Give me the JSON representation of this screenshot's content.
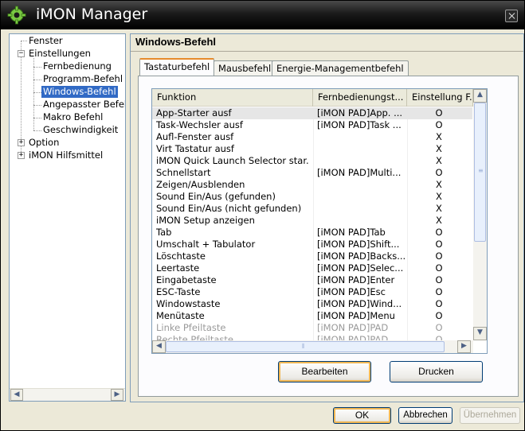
{
  "window": {
    "title": "iMON Manager"
  },
  "tree": {
    "items": [
      {
        "label": "Fenster"
      },
      {
        "label": "Einstellungen"
      },
      {
        "label": "Fernbedienung"
      },
      {
        "label": "Programm-Befehl"
      },
      {
        "label": "Windows-Befehl"
      },
      {
        "label": "Angepasster Befeh"
      },
      {
        "label": "Makro  Befehl"
      },
      {
        "label": "Geschwindigkeit"
      },
      {
        "label": "Option"
      },
      {
        "label": "iMON Hilfsmittel"
      }
    ]
  },
  "panel": {
    "title": "Windows-Befehl",
    "tabs": [
      {
        "label": "Tastaturbefehl"
      },
      {
        "label": "Mausbefehl"
      },
      {
        "label": "Energie-Managementbefehl"
      }
    ]
  },
  "list": {
    "columns": [
      "Funktion",
      "Fernbedienungst...",
      "Einstellung F..."
    ],
    "rows": [
      {
        "funktion": "App-Starter ausf",
        "taste": "[iMON PAD]App. ...",
        "einstellung": "O"
      },
      {
        "funktion": "Task-Wechsler ausf",
        "taste": "[iMON PAD]Task ...",
        "einstellung": "O"
      },
      {
        "funktion": "Aufl-Fenster ausf",
        "taste": "",
        "einstellung": "X"
      },
      {
        "funktion": "Virt Tastatur ausf",
        "taste": "",
        "einstellung": "X"
      },
      {
        "funktion": "iMON Quick Launch Selector star...",
        "taste": "",
        "einstellung": "X"
      },
      {
        "funktion": "Schnellstart",
        "taste": "[iMON PAD]Multi...",
        "einstellung": "O"
      },
      {
        "funktion": "Zeigen/Ausblenden",
        "taste": "",
        "einstellung": "X"
      },
      {
        "funktion": "Sound Ein/Aus (gefunden)",
        "taste": "",
        "einstellung": "X"
      },
      {
        "funktion": "Sound Ein/Aus (nicht gefunden)",
        "taste": "",
        "einstellung": "X"
      },
      {
        "funktion": "iMON Setup anzeigen",
        "taste": "",
        "einstellung": "X"
      },
      {
        "funktion": "Tab",
        "taste": "[iMON PAD]Tab",
        "einstellung": "O"
      },
      {
        "funktion": "Umschalt + Tabulator",
        "taste": "[iMON PAD]Shift...",
        "einstellung": "O"
      },
      {
        "funktion": "Löschtaste",
        "taste": "[iMON PAD]Backs...",
        "einstellung": "O"
      },
      {
        "funktion": "Leertaste",
        "taste": "[iMON PAD]Selec...",
        "einstellung": "O"
      },
      {
        "funktion": "Eingabetaste",
        "taste": "[iMON PAD]Enter",
        "einstellung": "O"
      },
      {
        "funktion": "ESC-Taste",
        "taste": "[iMON PAD]Esc",
        "einstellung": "O"
      },
      {
        "funktion": "Windowstaste",
        "taste": "[iMON PAD]Wind...",
        "einstellung": "O"
      },
      {
        "funktion": "Menütaste",
        "taste": "[iMON PAD]Menu",
        "einstellung": "O"
      },
      {
        "funktion": "Linke Pfeiltaste",
        "taste": "[iMON PAD]PAD",
        "einstellung": "O"
      },
      {
        "funktion": "Rechte Pfeiltaste",
        "taste": "[iMON PAD]PAD",
        "einstellung": "O"
      }
    ]
  },
  "buttons": {
    "edit": "Bearbeiten",
    "print": "Drucken",
    "ok": "OK",
    "cancel": "Abbrechen",
    "apply": "Übernehmen"
  }
}
